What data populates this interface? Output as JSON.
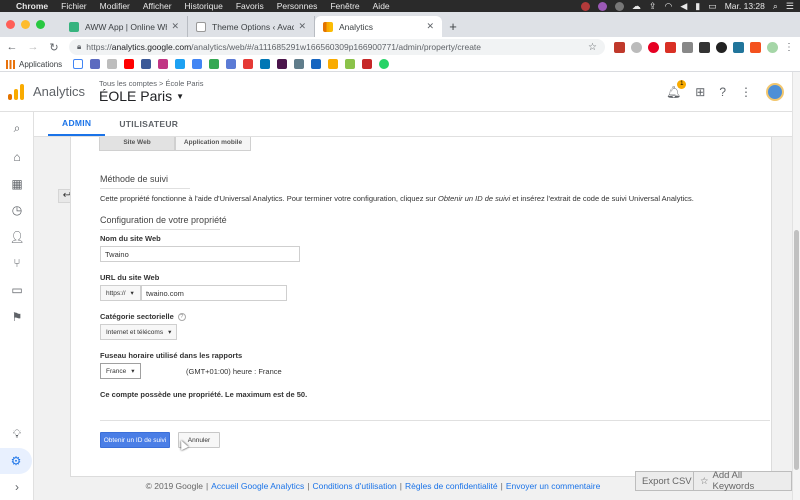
{
  "macos_menu": {
    "app": "Chrome",
    "items": [
      "Fichier",
      "Modifier",
      "Afficher",
      "Historique",
      "Favoris",
      "Personnes",
      "Fenêtre",
      "Aide"
    ],
    "clock": "Mar. 13:28"
  },
  "browser": {
    "tabs": [
      {
        "title": "AWW App | Online Whiteboard",
        "icon_color": "#36b37e"
      },
      {
        "title": "Theme Options ‹ Avada Seo —",
        "icon_color": "#888888"
      },
      {
        "title": "Analytics",
        "icon_color": "#f9ab00"
      }
    ],
    "url_prefix": "https://",
    "url_host": "analytics.google.com",
    "url_path": "/analytics/web/#/a111685291w166560309p166900771/admin/property/create",
    "bookmarks_label": "Applications"
  },
  "ga": {
    "product": "Analytics",
    "breadcrumb": "Tous les comptes > École Paris",
    "account_name": "ÉOLE Paris",
    "notification_count": "1"
  },
  "admin_tabs": [
    "ADMIN",
    "UTILISATEUR"
  ],
  "form": {
    "segments": [
      "Site Web",
      "Application mobile"
    ],
    "tracking_method_title": "Méthode de suivi",
    "tracking_text_before": "Cette propriété fonctionne à l'aide d'Universal Analytics. Pour terminer votre configuration, cliquez sur ",
    "tracking_text_em": "Obtenir un ID de suivi",
    "tracking_text_after": " et insérez l'extrait de code de suivi Universal Analytics.",
    "config_title": "Configuration de votre propriété",
    "site_name_label": "Nom du site Web",
    "site_name_value": "Twaino",
    "site_url_label": "URL du site Web",
    "protocol": "https://",
    "site_url_value": "twaino.com",
    "category_label": "Catégorie sectorielle",
    "category_value": "Internet et télécoms",
    "timezone_label": "Fuseau horaire utilisé dans les rapports",
    "timezone_country": "France",
    "timezone_value": "(GMT+01:00) heure : France",
    "limit_note": "Ce compte possède une propriété. Le maximum est de 50.",
    "primary_button": "Obtenir un ID de suivi",
    "cancel_button": "Annuler"
  },
  "footer": {
    "copyright": "© 2019 Google",
    "links": [
      "Accueil Google Analytics",
      "Conditions d'utilisation",
      "Règles de confidentialité",
      "Envoyer un commentaire"
    ]
  },
  "overlay_buttons": {
    "export": "Export CSV",
    "keywords": "Add All Keywords"
  },
  "colors": {
    "accent": "#1a73e8",
    "primary_button": "#4a7ee6",
    "ga_orange": "#f9ab00"
  }
}
